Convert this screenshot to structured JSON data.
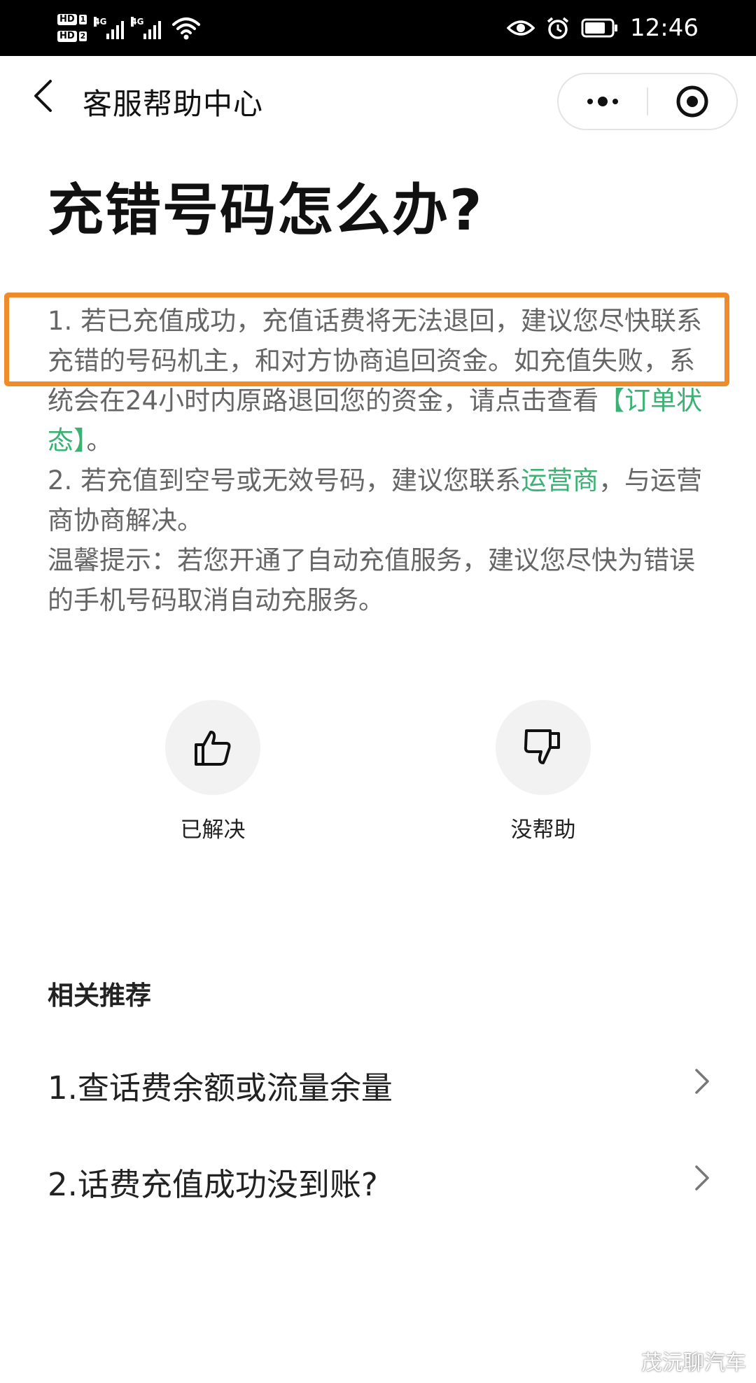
{
  "status_bar": {
    "sim1": "HD",
    "sim1_num": "1",
    "sim2": "HD",
    "sim2_num": "2",
    "network1": "4G",
    "network2": "4G",
    "time": "12:46"
  },
  "nav": {
    "title": "客服帮助中心",
    "back_icon": "chevron-left-icon",
    "more_icon": "more-dots-icon",
    "close_icon": "target-close-icon"
  },
  "article": {
    "title": "充错号码怎么办?",
    "p1_prefix": "1. 若已充值成功，充值话费将无法退回，建议您尽快联系充错的号码机主，和对方协商追回资金。如充值失败，系统会在24小时内原路退回您的资金，请点击查看",
    "p1_link": "【订单状态】",
    "p1_suffix": "。",
    "p2_prefix": "2. 若充值到空号或无效号码，建议您联系",
    "p2_link": "运营商",
    "p2_suffix": "，与运营商协商解决。",
    "p3": "温馨提示：若您开通了自动充值服务，建议您尽快为错误的手机号码取消自动充服务。"
  },
  "feedback": {
    "solved_label": "已解决",
    "unhelpful_label": "没帮助"
  },
  "recommend": {
    "heading": "相关推荐",
    "items": [
      {
        "label": "1.查话费余额或流量余量"
      },
      {
        "label": "2.话费充值成功没到账?"
      }
    ]
  },
  "watermark": "茂沅聊汽车",
  "colors": {
    "link": "#3bb273",
    "highlight_border": "#f08b2a"
  }
}
